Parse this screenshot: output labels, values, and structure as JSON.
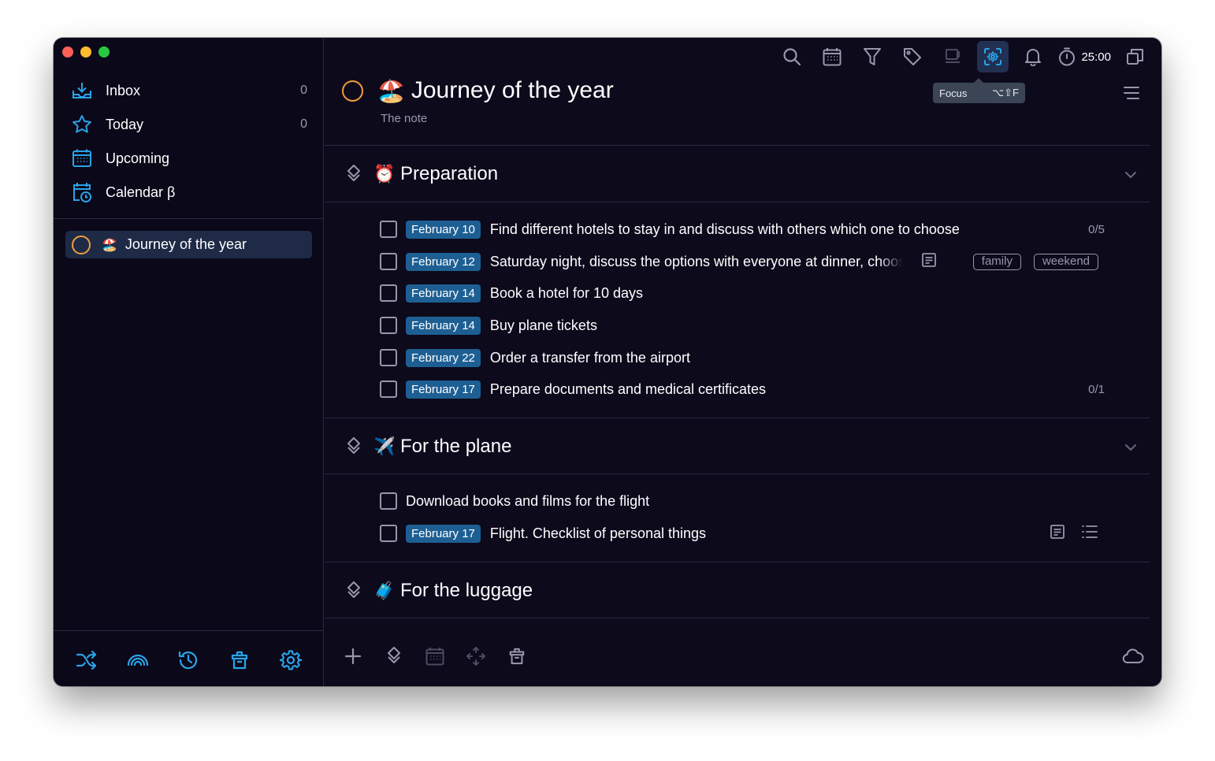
{
  "sidebar": {
    "nav": [
      {
        "label": "Inbox",
        "count": "0",
        "icon": "inbox-tray-icon"
      },
      {
        "label": "Today",
        "count": "0",
        "icon": "star-icon"
      },
      {
        "label": "Upcoming",
        "icon": "calendar-grid-icon"
      },
      {
        "label": "Calendar β",
        "icon": "calendar-clock-icon"
      }
    ],
    "project": {
      "emoji": "🏖️",
      "label": "Journey of the year"
    },
    "bottom_icons": [
      "shuffle-icon",
      "rainbow-icon",
      "history-icon",
      "trash-icon",
      "settings-icon"
    ]
  },
  "toolbar": {
    "timer": "25:00",
    "tooltip": {
      "label": "Focus",
      "shortcut": "⌥⇧F"
    }
  },
  "project": {
    "emoji": "🏖️",
    "title": "Journey of the year",
    "note": "The note"
  },
  "sections": [
    {
      "emoji": "⏰",
      "title": "Preparation",
      "tasks": [
        {
          "date": "February 10",
          "text": "Find different hotels to stay in and discuss with others which one to choose",
          "progress": "0/5"
        },
        {
          "date": "February 12",
          "text": "Saturday night, discuss the options with everyone at dinner, choose",
          "tags": [
            "family",
            "weekend"
          ]
        },
        {
          "date": "February 14",
          "text": "Book a hotel for 10 days"
        },
        {
          "date": "February 14",
          "text": "Buy plane tickets"
        },
        {
          "date": "February 22",
          "text": "Order a transfer from the airport"
        },
        {
          "date": "February 17",
          "text": "Prepare documents and medical certificates",
          "progress": "0/1"
        }
      ]
    },
    {
      "emoji": "✈️",
      "title": "For the plane",
      "tasks": [
        {
          "text": "Download books and films for the flight"
        },
        {
          "date": "February 17",
          "text": "Flight. Checklist of personal things"
        }
      ]
    },
    {
      "emoji": "🧳",
      "title": "For the luggage"
    }
  ],
  "colors": {
    "background": "#0d0a1c",
    "accent": "#2aa3e8",
    "date_badge": "#1e5f93",
    "project_ring": "#f29d38",
    "active_item": "#1e2a46"
  }
}
